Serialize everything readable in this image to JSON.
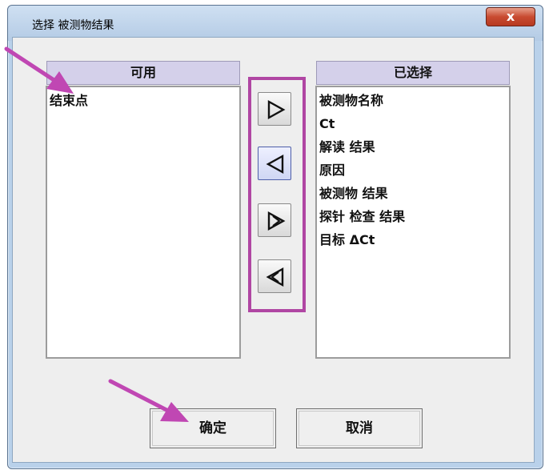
{
  "window": {
    "title": "选择 被测物结果",
    "close_glyph": "x"
  },
  "available": {
    "header": "可用",
    "items": [
      "结束点"
    ]
  },
  "selected": {
    "header": "已选择",
    "items": [
      "被测物名称",
      "Ct",
      "解读 结果",
      "原因",
      "被测物 结果",
      "探针 检查 结果",
      "目标 ΔCt"
    ]
  },
  "move_buttons": [
    {
      "icon": "arrow-right-icon"
    },
    {
      "icon": "arrow-left-icon"
    },
    {
      "icon": "double-arrow-right-icon"
    },
    {
      "icon": "double-arrow-left-icon"
    }
  ],
  "actions": {
    "ok_label": "确定",
    "cancel_label": "取消"
  },
  "colors": {
    "annotation": "#c047b3",
    "header_bg": "#d4d0ea",
    "title_bg": "#b9d1ea",
    "close_bg": "#c84b31"
  }
}
